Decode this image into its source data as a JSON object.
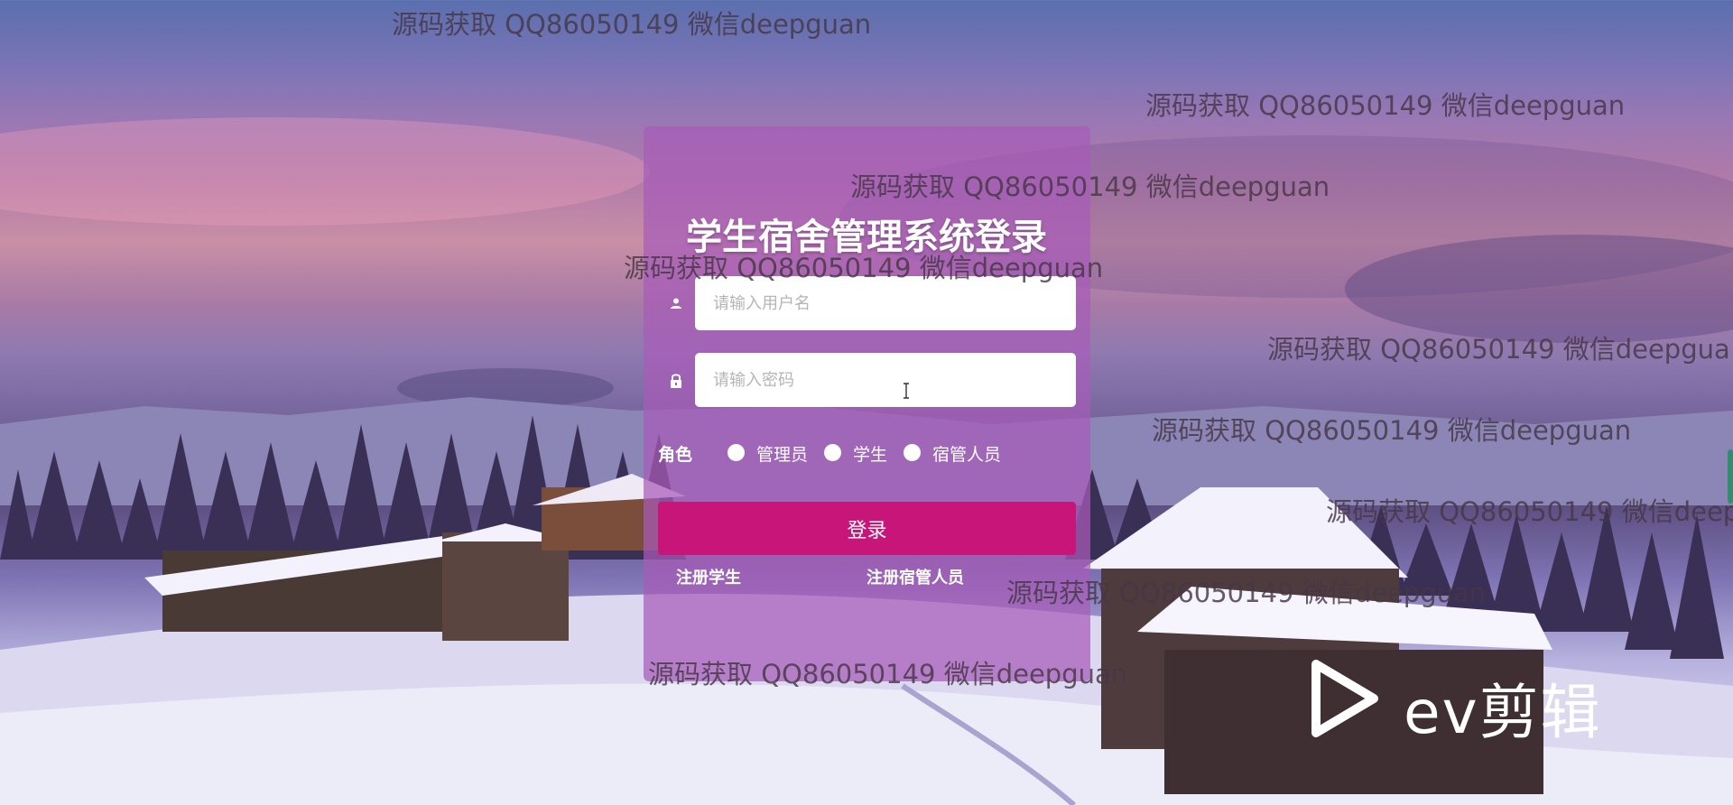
{
  "login": {
    "title": "学生宿舍管理系统登录",
    "username_placeholder": "请输入用户名",
    "password_placeholder": "请输入密码",
    "role_label": "角色",
    "roles": [
      "管理员",
      "学生",
      "宿管人员"
    ],
    "login_label": "登录",
    "register_student": "注册学生",
    "register_manager": "注册宿管人员"
  },
  "watermark": {
    "text": "源码获取 QQ86050149 微信deepguan",
    "text_clipped_1": "源码获取 QQ86050149 微信deepgua",
    "text_clipped_2": "源码获取 QQ86050149 微信deep"
  },
  "overlay": {
    "brand": "ev剪辑"
  },
  "colors": {
    "panel": "#a75cb9",
    "button": "#c8157a",
    "watermark": "#463746"
  },
  "icons": {
    "username": "user-icon",
    "password": "lock-icon",
    "brand": "play-icon"
  }
}
